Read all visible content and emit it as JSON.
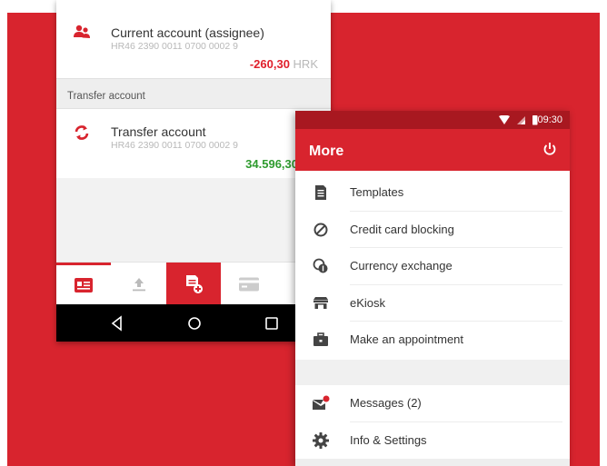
{
  "colors": {
    "brand_red": "#d8242e",
    "status_bar_red": "#a81820",
    "negative_amount": "#e0202c",
    "positive_amount": "#2e9b2e"
  },
  "left_phone": {
    "accounts": [
      {
        "icon": "people-icon",
        "name": "Current account (assignee)",
        "iban": "HR46 2390 0011 0700 0002 9",
        "balance": "-260,30",
        "currency": "HRK"
      },
      {
        "icon": "transfer-arrows-icon",
        "name": "Transfer account",
        "iban": "HR46 2390 0011 0700 0002 9",
        "balance": "34.596,30",
        "currency": ""
      }
    ],
    "section_header": "Transfer account",
    "bottom_tabs": [
      {
        "icon": "accounts-card-icon",
        "active": true
      },
      {
        "icon": "upload-icon",
        "active": false
      },
      {
        "icon": "new-payment-icon",
        "active": false
      },
      {
        "icon": "credit-card-icon",
        "active": false
      }
    ],
    "nav_buttons": [
      "back-icon",
      "home-icon",
      "recents-icon"
    ]
  },
  "right_phone": {
    "status_time": "09:30",
    "app_title": "More",
    "menu_items": [
      {
        "icon": "document-icon",
        "label": "Templates"
      },
      {
        "icon": "block-icon",
        "label": "Credit card blocking"
      },
      {
        "icon": "currency-exchange-icon",
        "label": "Currency exchange"
      },
      {
        "icon": "kiosk-icon",
        "label": "eKiosk"
      },
      {
        "icon": "briefcase-icon",
        "label": "Make an appointment"
      }
    ],
    "menu_items_2": [
      {
        "icon": "messages-icon",
        "label": "Messages (2)"
      },
      {
        "icon": "gear-icon",
        "label": "Info & Settings"
      }
    ]
  }
}
